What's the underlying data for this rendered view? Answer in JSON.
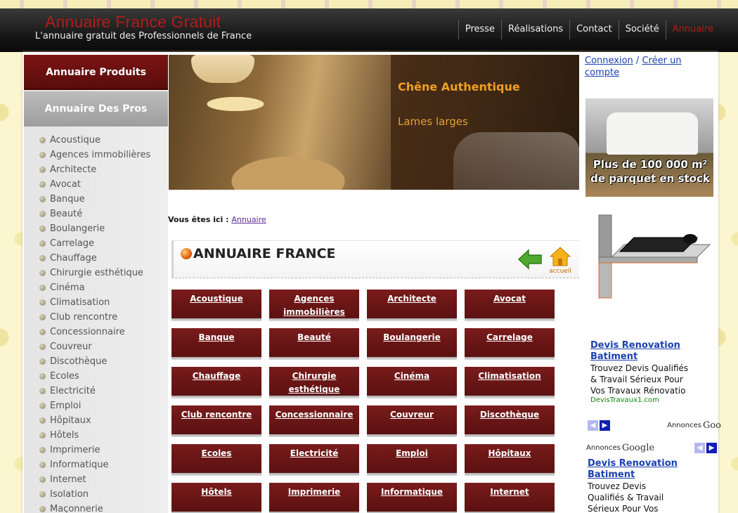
{
  "header": {
    "site_title": "Annuaire France Gratuit",
    "tagline": "L'annuaire gratuit des Professionnels de France",
    "nav": [
      {
        "label": "Presse",
        "active": false
      },
      {
        "label": "Réalisations",
        "active": false
      },
      {
        "label": "Contact",
        "active": false
      },
      {
        "label": "Société",
        "active": false
      },
      {
        "label": "Annuaire",
        "active": true
      }
    ]
  },
  "sidebar": {
    "products_label": "Annuaire Produits",
    "pros_label": "Annuaire Des Pros",
    "items": [
      "Acoustique",
      "Agences immobilières",
      "Architecte",
      "Avocat",
      "Banque",
      "Beauté",
      "Boulangerie",
      "Carrelage",
      "Chauffage",
      "Chirurgie esthétique",
      "Cinéma",
      "Climatisation",
      "Club rencontre",
      "Concessionnaire",
      "Couvreur",
      "Discothèque",
      "Ecoles",
      "Electricité",
      "Emploi",
      "Hôpitaux",
      "Hôtels",
      "Imprimerie",
      "Informatique",
      "Internet",
      "Isolation",
      "Maçonnerie"
    ]
  },
  "banner": {
    "title": "Chêne Authentique",
    "subtitle": "Lames larges"
  },
  "breadcrumb": {
    "prefix": "Vous êtes ici :",
    "link": "Annuaire"
  },
  "main": {
    "page_title": "ANNUAIRE FRANCE",
    "home_label": "accueil",
    "categories": [
      "Acoustique",
      "Agences immobilières",
      "Architecte",
      "Avocat",
      "Banque",
      "Beauté",
      "Boulangerie",
      "Carrelage",
      "Chauffage",
      "Chirurgie esthétique",
      "Cinéma",
      "Climatisation",
      "Club rencontre",
      "Concessionnaire",
      "Couvreur",
      "Discothèque",
      "Ecoles",
      "Electricité",
      "Emploi",
      "Hôpitaux",
      "Hôtels",
      "Imprimerie",
      "Informatique",
      "Internet"
    ]
  },
  "right": {
    "login_label": "Connexion",
    "separator": "/",
    "register_label": "Créer un compte",
    "stock_ad_line1": "Plus de 100 000 m²",
    "stock_ad_line2": "de parquet en stock",
    "ads": [
      {
        "title": "Devis Renovation Batiment",
        "body": [
          "Trouvez Devis Qualifiés",
          "& Travail Sérieux Pour",
          "Vos Travaux Rénovatio"
        ],
        "url": "DevisTravaux1.com",
        "annonces": "Annonces",
        "google": "Goo"
      },
      {
        "title": "Devis Renovation Batiment",
        "body": [
          "Trouvez Devis",
          "Qualifiés & Travail",
          "Sérieux Pour Vos"
        ],
        "annonces": "Annonces",
        "google": "Google"
      }
    ]
  },
  "colors": {
    "accent_red": "#b51a1a",
    "category_bg": "#6b1616",
    "header_bg": "#141414",
    "banner_gold": "#f0a020",
    "link_blue": "#1a3fb0"
  }
}
